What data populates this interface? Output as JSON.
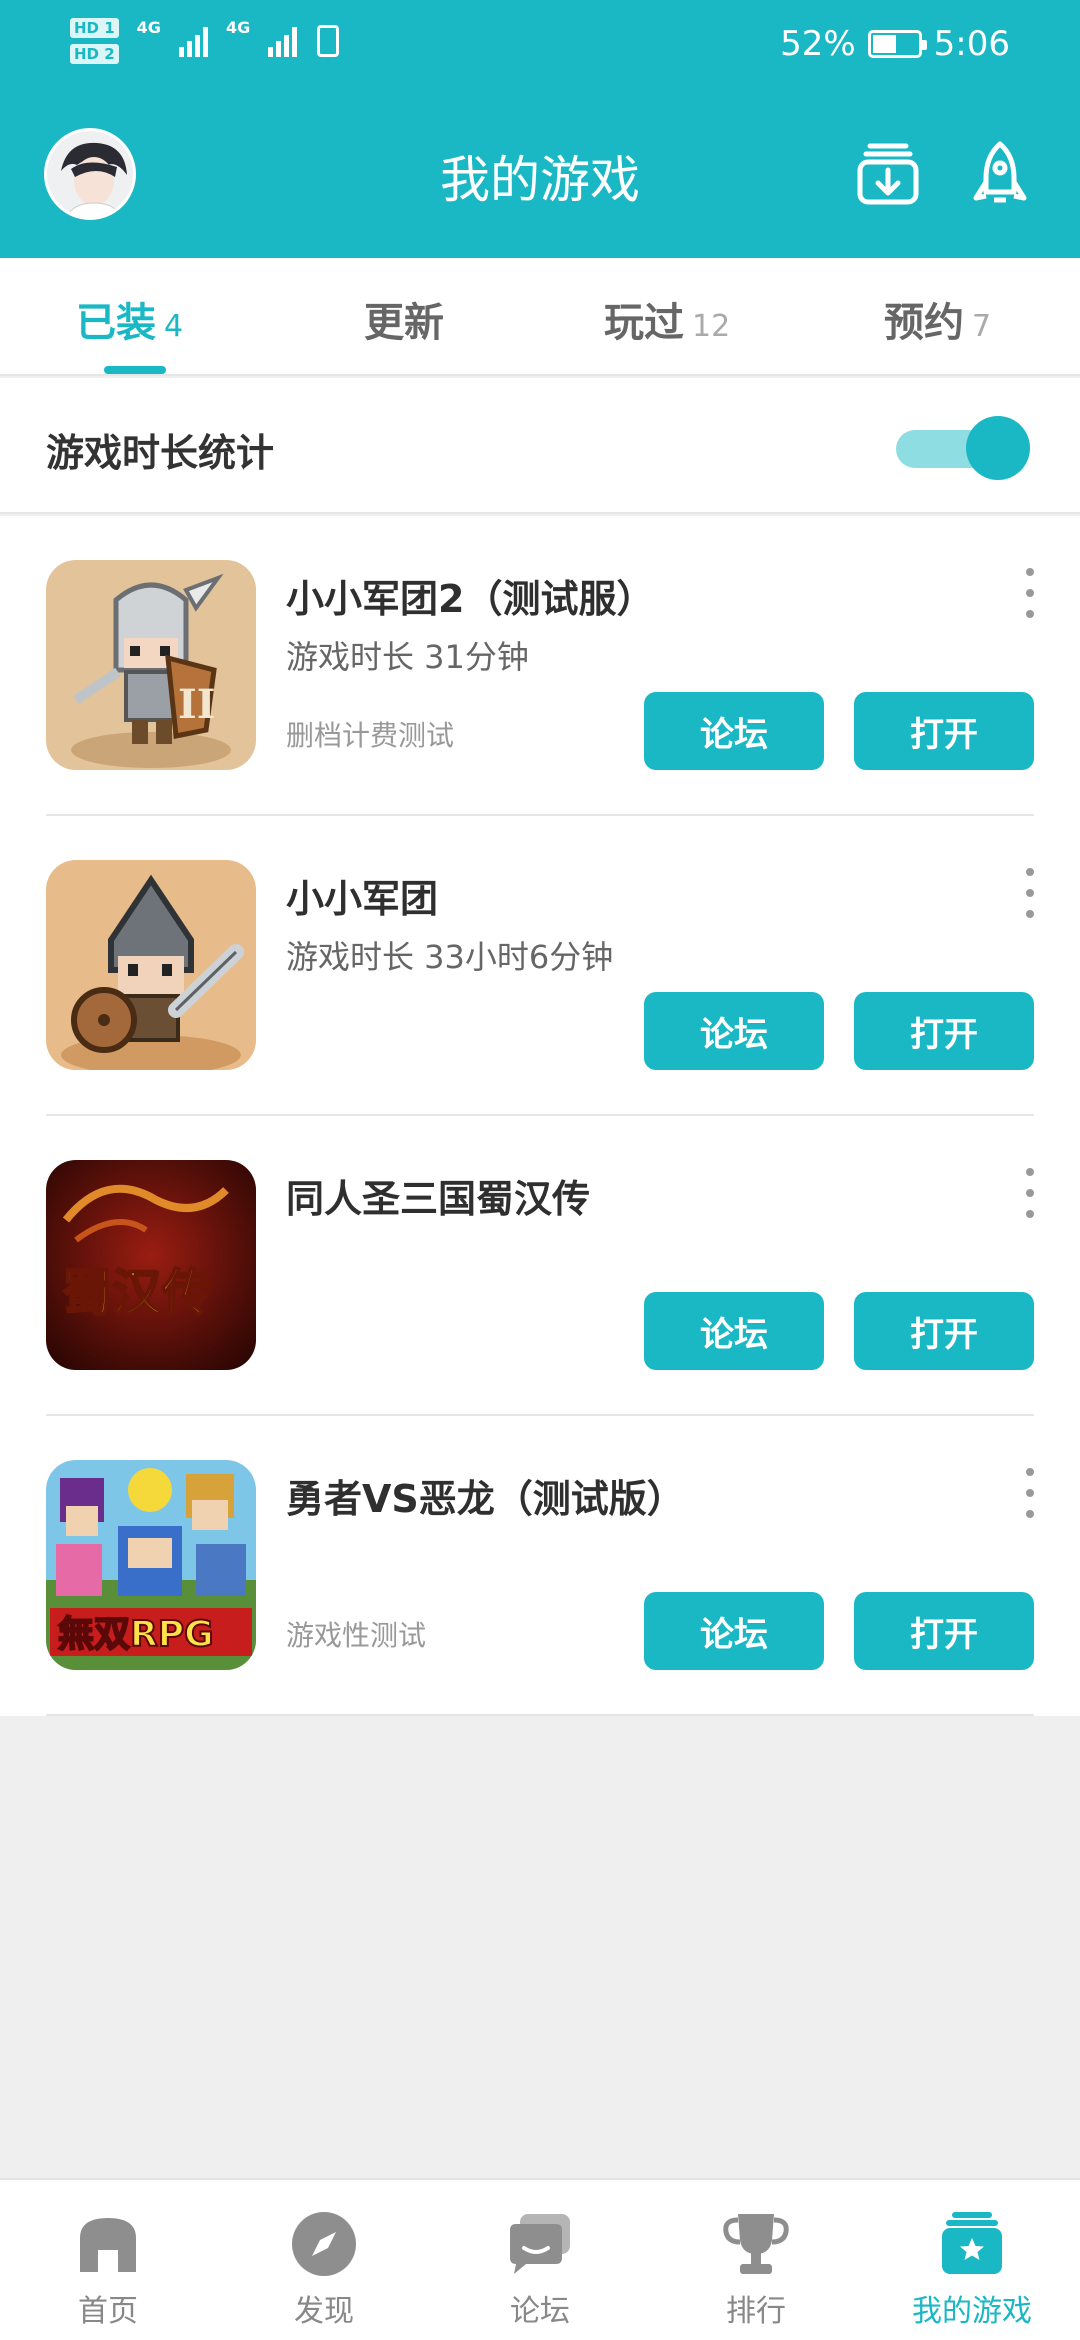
{
  "status_bar": {
    "hd1": "HD 1",
    "hd2": "HD 2",
    "net1": "4G",
    "net2": "4G",
    "battery_percent": "52%",
    "battery_level": 0.52,
    "time": "5:06"
  },
  "header": {
    "title": "我的游戏",
    "download_icon": "download-box-icon",
    "rocket_icon": "rocket-icon"
  },
  "tabs": [
    {
      "label": "已装",
      "count": "4",
      "active": true
    },
    {
      "label": "更新",
      "count": "",
      "active": false
    },
    {
      "label": "玩过",
      "count": "12",
      "active": false
    },
    {
      "label": "预约",
      "count": "7",
      "active": false
    }
  ],
  "stats": {
    "label": "游戏时长统计",
    "enabled": true
  },
  "games": [
    {
      "name": "小小军团2（测试服）",
      "duration": "游戏时长 31分钟",
      "note": "删档计费测试",
      "forum_label": "论坛",
      "open_label": "打开"
    },
    {
      "name": "小小军团",
      "duration": "游戏时长 33小时6分钟",
      "note": "",
      "forum_label": "论坛",
      "open_label": "打开"
    },
    {
      "name": "同人圣三国蜀汉传",
      "duration": "",
      "note": "",
      "icon_text": "蜀汉传",
      "forum_label": "论坛",
      "open_label": "打开"
    },
    {
      "name": "勇者VS恶龙（测试版）",
      "duration": "",
      "note": "游戏性测试",
      "icon_text": "無双RPG",
      "forum_label": "论坛",
      "open_label": "打开"
    }
  ],
  "bottom_nav": [
    {
      "label": "首页",
      "icon": "home-icon",
      "active": false
    },
    {
      "label": "发现",
      "icon": "compass-icon",
      "active": false
    },
    {
      "label": "论坛",
      "icon": "forum-chat-icon",
      "active": false
    },
    {
      "label": "排行",
      "icon": "trophy-icon",
      "active": false
    },
    {
      "label": "我的游戏",
      "icon": "my-games-star-icon",
      "active": true
    }
  ],
  "colors": {
    "accent": "#1ab8c4",
    "toggle_track": "#8edde2",
    "background": "#efefef"
  }
}
